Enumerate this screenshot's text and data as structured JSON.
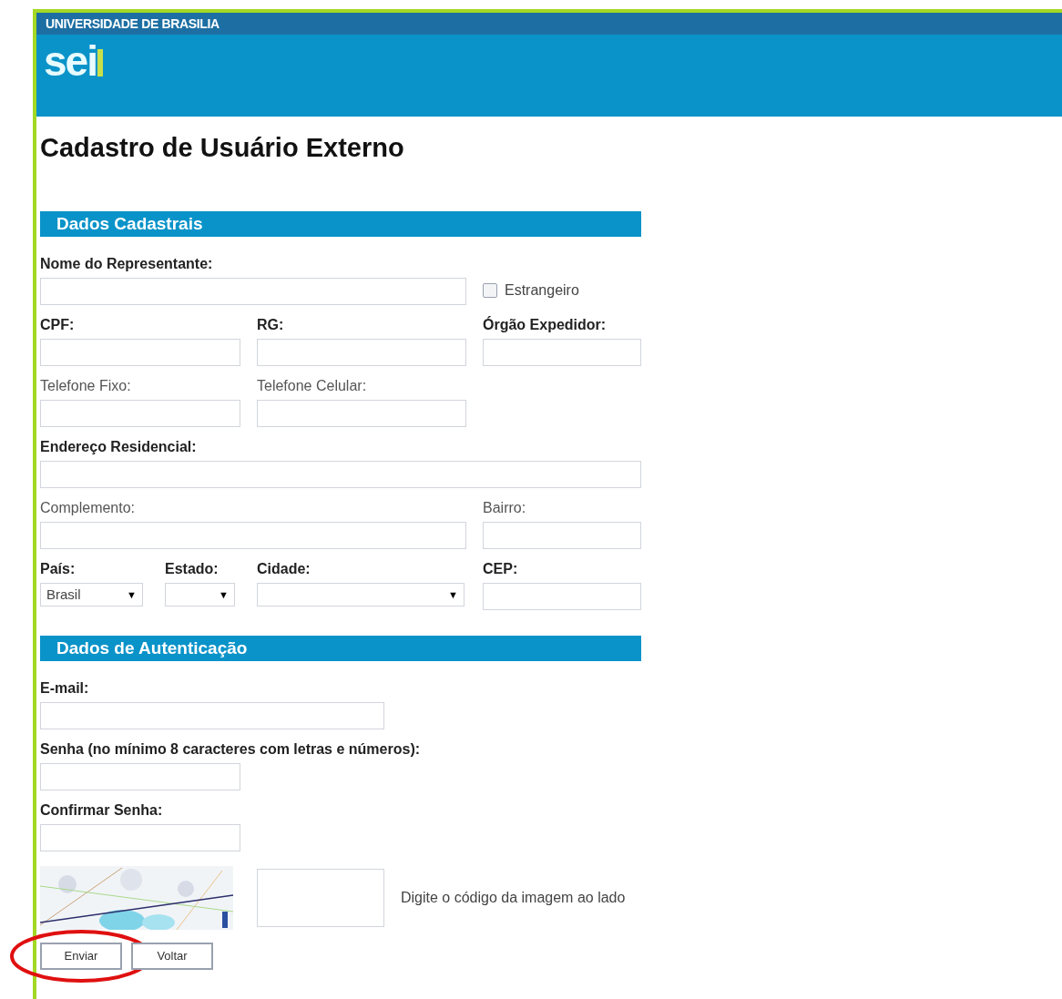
{
  "header": {
    "institution": "UNIVERSIDADE DE BRASILIA",
    "logo": "sei"
  },
  "page_title": "Cadastro de Usuário Externo",
  "sections": [
    {
      "title": "Dados Cadastrais",
      "fields": [
        {
          "kind": "text",
          "label": "Nome do Representante:",
          "required": true
        },
        {
          "kind": "checkbox",
          "label": "Estrangeiro",
          "checked": false
        },
        {
          "kind": "text",
          "label": "CPF:",
          "required": true
        },
        {
          "kind": "text",
          "label": "RG:",
          "required": true
        },
        {
          "kind": "text",
          "label": "Órgão Expedidor:",
          "required": true
        },
        {
          "kind": "text",
          "label": "Telefone Fixo:",
          "required": false
        },
        {
          "kind": "text",
          "label": "Telefone Celular:",
          "required": false
        },
        {
          "kind": "text",
          "label": "Endereço Residencial:",
          "required": true
        },
        {
          "kind": "text",
          "label": "Complemento:",
          "required": false
        },
        {
          "kind": "text",
          "label": "Bairro:",
          "required": false
        },
        {
          "kind": "select",
          "label": "País:",
          "required": true,
          "value": "Brasil",
          "arrow": "▼"
        },
        {
          "kind": "select",
          "label": "Estado:",
          "required": true,
          "arrow": "▼"
        },
        {
          "kind": "select",
          "label": "Cidade:",
          "required": true,
          "arrow": "▼"
        },
        {
          "kind": "text",
          "label": "CEP:",
          "required": true
        }
      ]
    },
    {
      "title": "Dados de Autenticação",
      "fields": [
        {
          "kind": "text",
          "label": "E-mail:",
          "required": true
        },
        {
          "kind": "text",
          "label": "Senha (no mínimo 8 caracteres com letras e números):",
          "required": true
        },
        {
          "kind": "text",
          "label": "Confirmar Senha:",
          "required": true
        }
      ]
    }
  ],
  "captcha": {
    "hint": "Digite o código da imagem ao lado"
  },
  "buttons": [
    {
      "label": "Enviar",
      "highlighted": true
    },
    {
      "label": "Voltar",
      "highlighted": false
    }
  ]
}
